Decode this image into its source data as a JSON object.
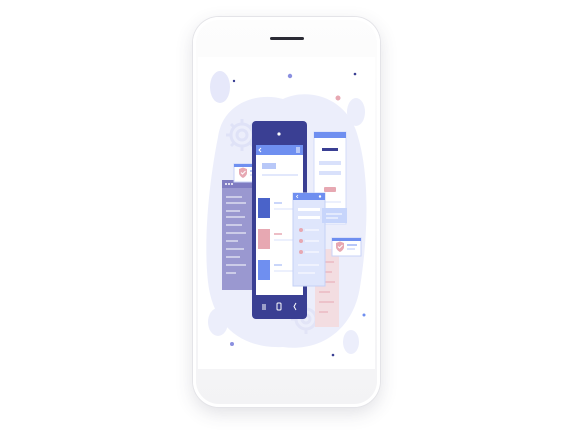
{
  "device": {
    "model": "smartphone"
  },
  "illustration": {
    "subject": "mobile-app-screens",
    "colors": {
      "navy": "#3a3f93",
      "blue": "#6f8ff0",
      "light_blue": "#b8c8f8",
      "lavender": "#eceefb",
      "purple": "#9a98d0",
      "pink": "#e7a8b2",
      "white": "#ffffff"
    },
    "icons": [
      "shield-check-icon",
      "shield-check-icon",
      "gear-icon",
      "home-icon",
      "back-icon",
      "menu-icon"
    ]
  }
}
